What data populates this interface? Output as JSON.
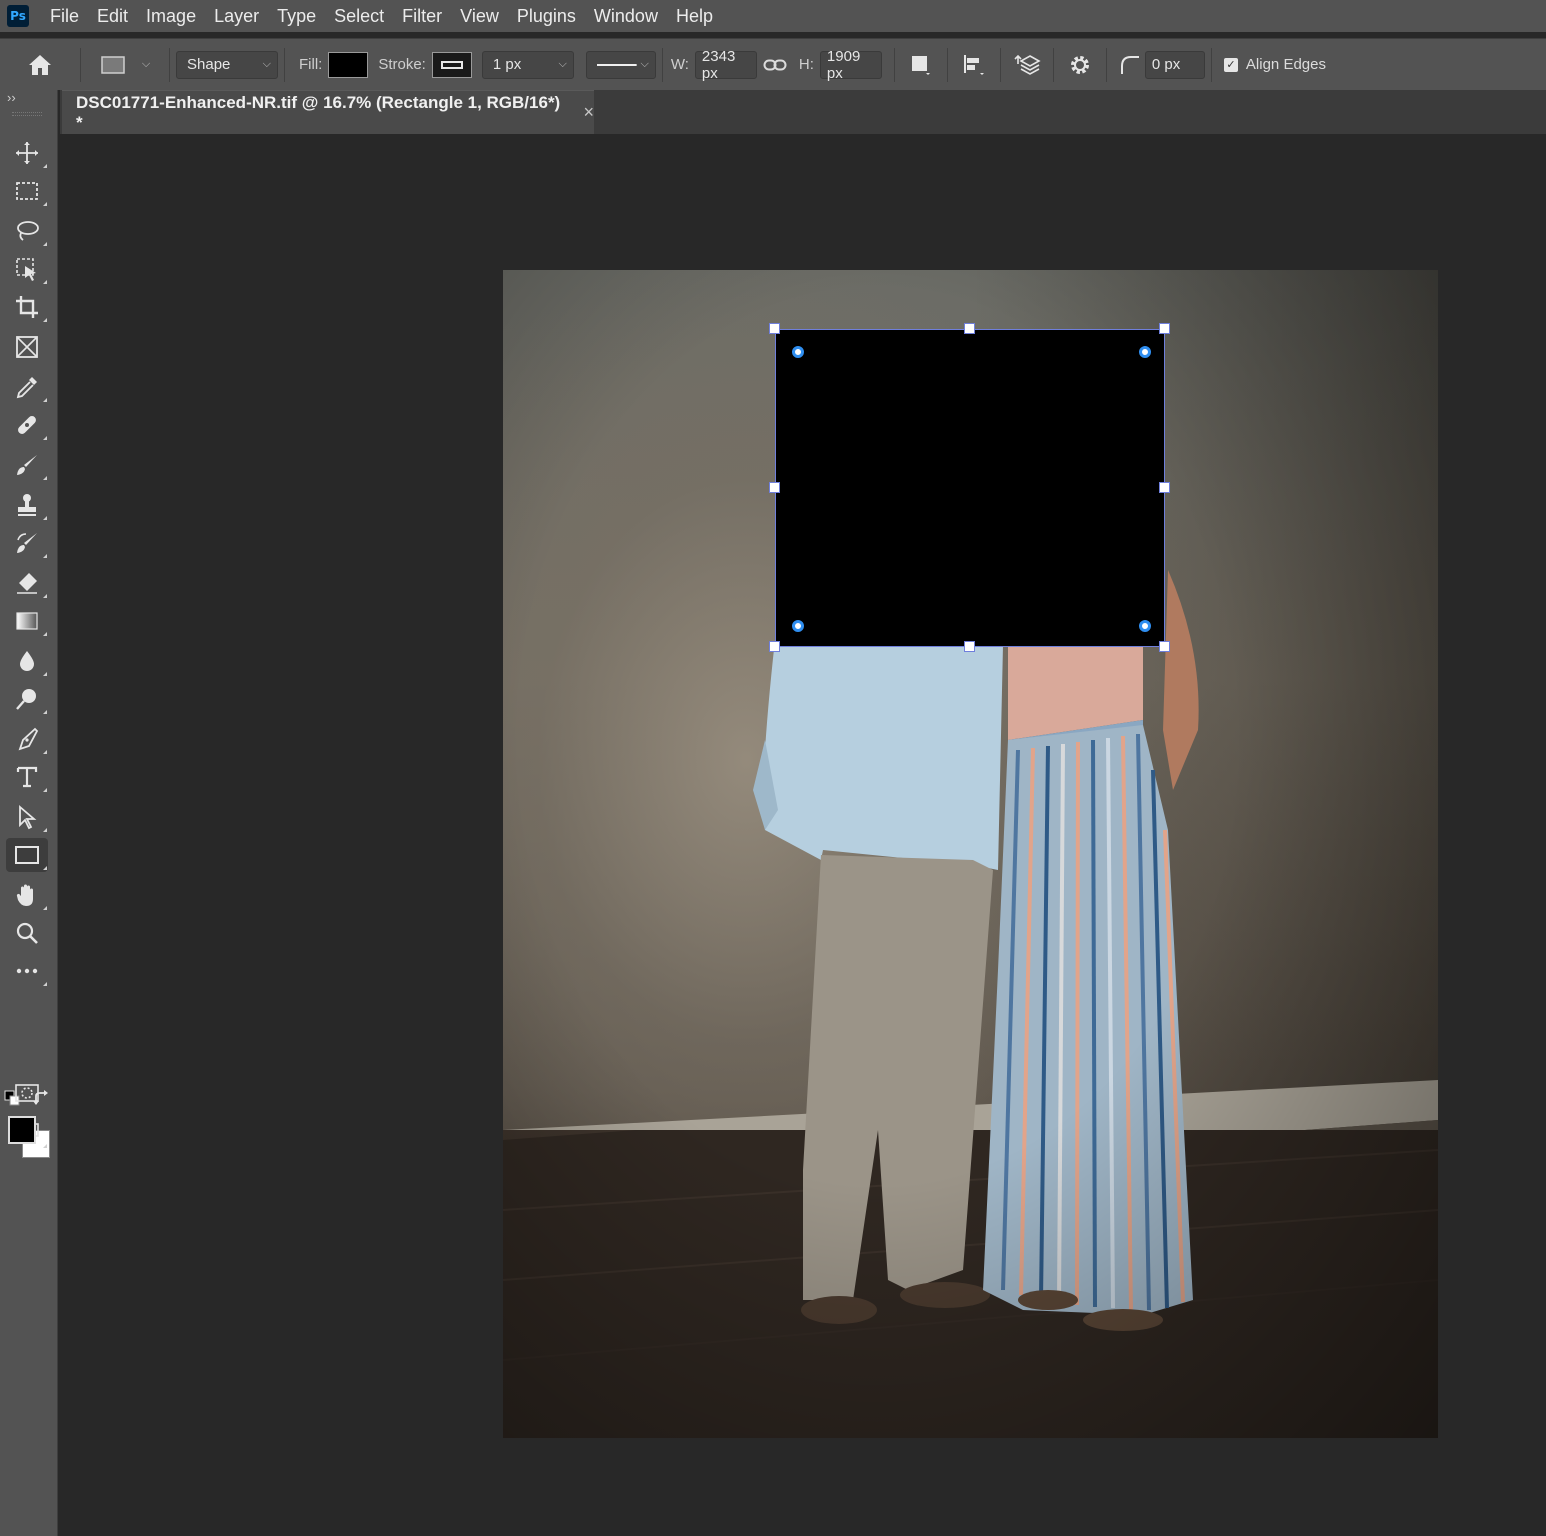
{
  "app": {
    "logo_text": "Ps",
    "menu": [
      "File",
      "Edit",
      "Image",
      "Layer",
      "Type",
      "Select",
      "Filter",
      "View",
      "Plugins",
      "Window",
      "Help"
    ]
  },
  "options": {
    "mode": "Shape",
    "fill_label": "Fill:",
    "stroke_label": "Stroke:",
    "stroke_width": "1 px",
    "w_label": "W:",
    "w_value": "2343 px",
    "h_label": "H:",
    "h_value": "1909 px",
    "radius_value": "0 px",
    "align_edges_label": "Align Edges",
    "align_edges_checked": true,
    "fill_color": "#000000"
  },
  "document": {
    "tab_title": "DSC01771-Enhanced-NR.tif @ 16.7% (Rectangle 1, RGB/16*) *",
    "close_glyph": "×"
  },
  "toolbar": {
    "collapse_glyph": "››",
    "tools": [
      "move-tool",
      "rectangular-marquee-tool",
      "lasso-tool",
      "object-selection-tool",
      "crop-tool",
      "frame-tool",
      "eyedropper-tool",
      "spot-healing-tool",
      "brush-tool",
      "clone-stamp-tool",
      "history-brush-tool",
      "eraser-tool",
      "gradient-tool",
      "blur-tool",
      "dodge-tool",
      "pen-tool",
      "type-tool",
      "path-selection-tool",
      "rectangle-tool",
      "hand-tool",
      "zoom-tool",
      "edit-toolbar"
    ],
    "active_tool": "rectangle-tool",
    "foreground_color": "#000000",
    "background_color": "#ffffff"
  }
}
